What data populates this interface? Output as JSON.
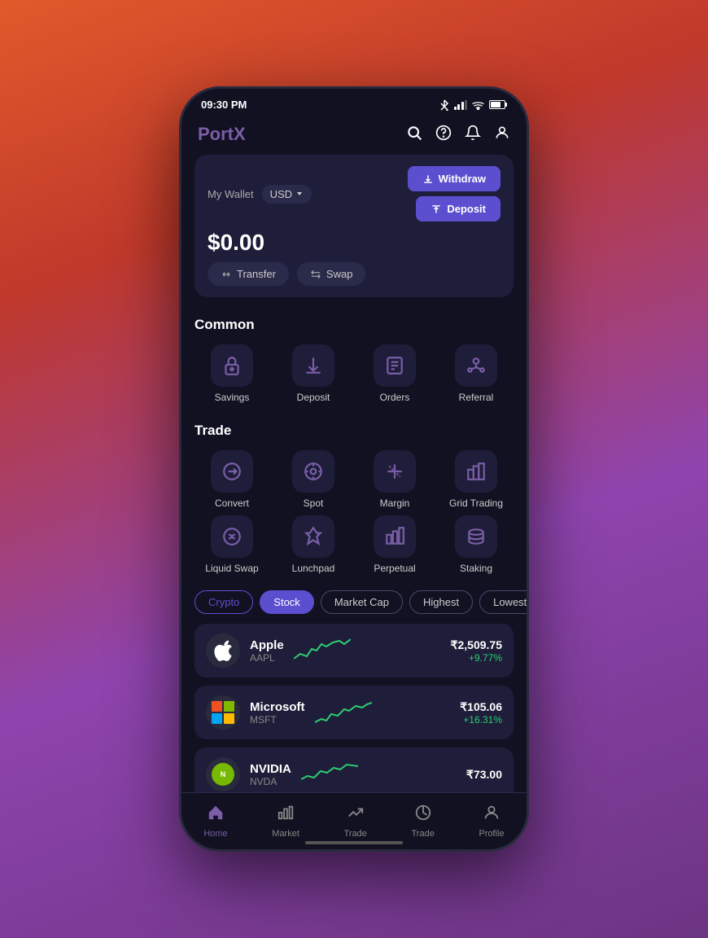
{
  "status_bar": {
    "time": "09:30 PM",
    "bluetooth": "⚡",
    "signal": "▪▪▪",
    "wifi": "WiFi",
    "battery": "65%"
  },
  "header": {
    "logo_port": "Port",
    "logo_x": "X",
    "search_icon": "🔍",
    "help_icon": "?",
    "notification_icon": "🔔",
    "profile_icon": "👤"
  },
  "wallet": {
    "label": "My Wallet",
    "currency": "USD",
    "balance": "$0.00",
    "withdraw_label": "Withdraw",
    "deposit_label": "Deposit",
    "transfer_label": "Transfer",
    "swap_label": "Swap"
  },
  "common": {
    "title": "Common",
    "items": [
      {
        "icon": "🔒",
        "label": "Savings"
      },
      {
        "icon": "⬇️",
        "label": "Deposit"
      },
      {
        "icon": "📋",
        "label": "Orders"
      },
      {
        "icon": "👥",
        "label": "Referral"
      }
    ]
  },
  "trade": {
    "title": "Trade",
    "items": [
      {
        "icon": "🔄",
        "label": "Convert"
      },
      {
        "icon": "📍",
        "label": "Spot"
      },
      {
        "icon": "⚖️",
        "label": "Margin"
      },
      {
        "icon": "📊",
        "label": "Grid Trading"
      },
      {
        "icon": "💧",
        "label": "Liquid Swap"
      },
      {
        "icon": "📌",
        "label": "Lunchpad"
      },
      {
        "icon": "📈",
        "label": "Perpetual"
      },
      {
        "icon": "🥞",
        "label": "Staking"
      }
    ]
  },
  "filter": {
    "tabs": [
      {
        "label": "Crypto",
        "active": false,
        "outline": true
      },
      {
        "label": "Stock",
        "active": true,
        "outline": false
      },
      {
        "label": "Market Cap",
        "active": false,
        "outline": false
      },
      {
        "label": "Highest",
        "active": false,
        "outline": false
      },
      {
        "label": "Lowest",
        "active": false,
        "outline": false
      }
    ]
  },
  "stocks": [
    {
      "name": "Apple",
      "ticker": "AAPL",
      "price": "₹2,509.75",
      "change": "+9.77%",
      "positive": true
    },
    {
      "name": "Microsoft",
      "ticker": "MSFT",
      "price": "₹105.06",
      "change": "+16.31%",
      "positive": true
    },
    {
      "name": "NVIDIA",
      "ticker": "NVDA",
      "price": "₹73.00",
      "change": "",
      "positive": true
    }
  ],
  "bottom_nav": [
    {
      "icon": "🏠",
      "label": "Home",
      "active": true
    },
    {
      "icon": "📊",
      "label": "Market",
      "active": false
    },
    {
      "icon": "📈",
      "label": "Trade",
      "active": false
    },
    {
      "icon": "🥧",
      "label": "Trade",
      "active": false
    },
    {
      "icon": "👤",
      "label": "Profile",
      "active": false
    }
  ]
}
